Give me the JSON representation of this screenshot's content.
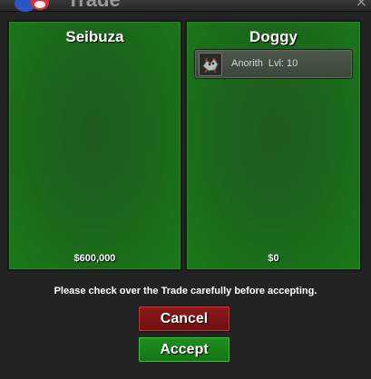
{
  "window": {
    "title": "Trade",
    "close_glyph": "×",
    "title_icon": "pokeball-icon"
  },
  "left_panel": {
    "name": "Seibuza",
    "amount": "$600,000",
    "items": []
  },
  "right_panel": {
    "name": "Doggy",
    "amount": "$0",
    "items": [
      {
        "name": "Anorith",
        "level": "Lvl: 10",
        "icon": "anorith-icon"
      }
    ]
  },
  "instructions": "Please check over the Trade carefully before accepting.",
  "buttons": {
    "cancel_label": "Cancel",
    "accept_label": "Accept"
  },
  "colors": {
    "panel_green": "#1c651c",
    "cancel_red": "#8e1a1a",
    "accept_green": "#1f8f1f"
  }
}
